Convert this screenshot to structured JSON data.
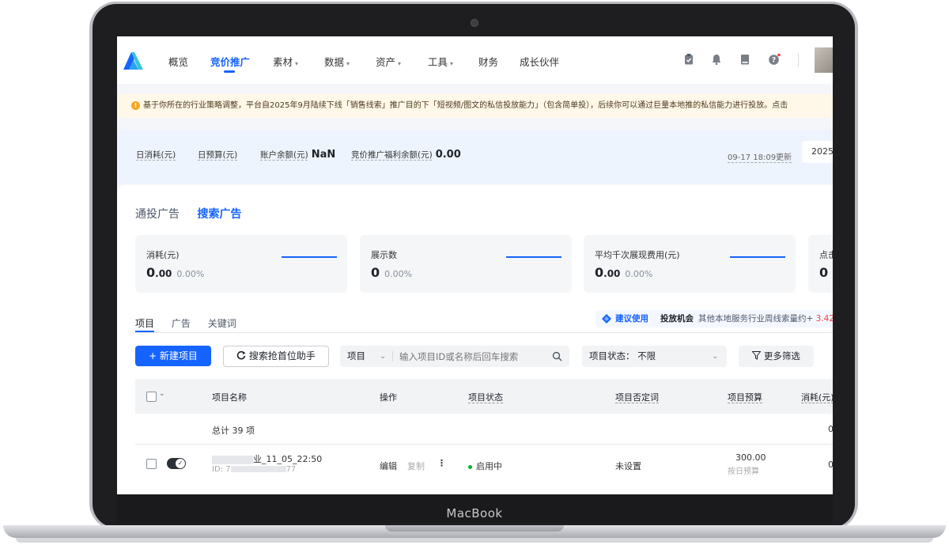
{
  "device": {
    "brand_label": "MacBook"
  },
  "nav": {
    "items": [
      {
        "label": "概览",
        "dropdown": false
      },
      {
        "label": "竞价推广",
        "dropdown": false,
        "active": true
      },
      {
        "label": "素材",
        "dropdown": true
      },
      {
        "label": "数据",
        "dropdown": true
      },
      {
        "label": "资产",
        "dropdown": true
      },
      {
        "label": "工具",
        "dropdown": true
      },
      {
        "label": "财务",
        "dropdown": false
      },
      {
        "label": "成长伙伴",
        "dropdown": false
      }
    ],
    "caret": "▾",
    "tools": [
      "clipboard-icon",
      "bell-icon",
      "book-icon",
      "help-icon"
    ],
    "accent": "#1664ff"
  },
  "notice": {
    "icon": "!",
    "text": "基于你所在的行业策略调整，平台自2025年9月陆续下线「销售线索」推广目的下「短视频/图文的私信投放能力」（包含简单投），后续你可以通过巨量本地推的私信能力进行投放。点击"
  },
  "summary": {
    "daily_spend_label": "日消耗(元)",
    "daily_budget_label": "日预算(元)",
    "balance_label": "账户余额(元)",
    "balance_value": "NaN",
    "rebate_label": "竞价推广福利余额(元)",
    "rebate_value": "0.00",
    "updated": "09-17 18:09更新",
    "date": "2025"
  },
  "tabs": {
    "general": "通投广告",
    "search": "搜索广告"
  },
  "cards": [
    {
      "label": "消耗(元)",
      "int": "0",
      "dec": ".00",
      "pct": "0.00%"
    },
    {
      "label": "展示数",
      "int": "0",
      "dec": "",
      "pct": "0.00%"
    },
    {
      "label": "平均千次展现费用(元)",
      "int": "0",
      "dec": ".00",
      "pct": "0.00%"
    },
    {
      "label": "点击",
      "int": "0",
      "dec": "",
      "pct": ""
    }
  ],
  "subtabs": [
    "项目",
    "广告",
    "关键词"
  ],
  "suggest": {
    "tag": "建议使用",
    "title": "投放机会",
    "desc": "其他本地服务行业周线索量约+",
    "num": "3.42"
  },
  "toolbar": {
    "new_project": "+ 新建项目",
    "assistant": "搜索抢首位助手",
    "select_label": "项目",
    "search_placeholder": "输入项目ID或名称后回车搜索",
    "status_label": "项目状态： 不限",
    "more_filters": "更多筛选"
  },
  "table": {
    "headers": {
      "name": "项目名称",
      "op": "操作",
      "status": "项目状态",
      "negative": "项目否定词",
      "budget": "项目预算",
      "spend": "消耗(元)"
    },
    "total_label": "总计 39 项",
    "total_spend": "0",
    "rows": [
      {
        "name_prefix": "",
        "name_suffix": "业_11_05_22:50",
        "id_prefix": "ID: 7",
        "id_suffix": "77",
        "edit": "编辑",
        "copy": "复制",
        "status": "启用中",
        "negative": "未设置",
        "budget": "300.00",
        "budget_type": "按日预算",
        "spend": "0"
      }
    ]
  }
}
